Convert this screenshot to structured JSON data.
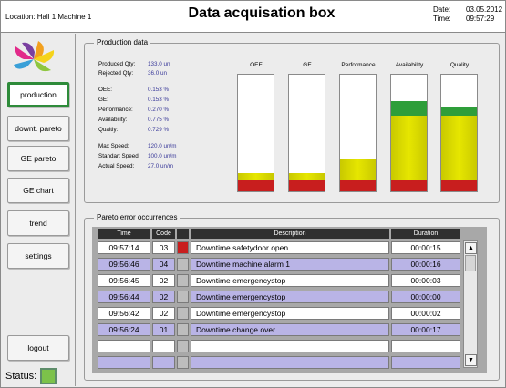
{
  "header": {
    "location": "Location: Hall 1 Machine 1",
    "title": "Data acquisation box",
    "date_label": "Date:",
    "date_value": "03.05.2012",
    "time_label": "Time:",
    "time_value": "09:57:29"
  },
  "sidebar": {
    "items": [
      {
        "label": "production",
        "active": true
      },
      {
        "label": "downt. pareto"
      },
      {
        "label": "GE pareto"
      },
      {
        "label": "GE chart"
      },
      {
        "label": "trend"
      },
      {
        "label": "settings"
      }
    ],
    "logout": "logout",
    "status_label": "Status:",
    "status_color": "#7cc24a"
  },
  "production": {
    "title": "Production data",
    "stats": [
      {
        "label": "Produced Qty:",
        "value": "133.0 un"
      },
      {
        "label": "Rejected Qty:",
        "value": "36.0 un"
      },
      {
        "label": "OEE:",
        "value": "0.153 %"
      },
      {
        "label": "GE:",
        "value": "0.153 %"
      },
      {
        "label": "Performance:",
        "value": "0.270  %"
      },
      {
        "label": "Availability:",
        "value": "0.775 %"
      },
      {
        "label": "Qualtiy:",
        "value": "0.729 %"
      },
      {
        "label": "Max Speed:",
        "value": "120.0 un/m"
      },
      {
        "label": "Standart Speed:",
        "value": "100.0 un/m"
      },
      {
        "label": "Actual Speed:",
        "value": "27.0 un/m"
      }
    ],
    "gauges": [
      {
        "label": "OEE",
        "fraction": 0.153
      },
      {
        "label": "GE",
        "fraction": 0.153
      },
      {
        "label": "Performance",
        "fraction": 0.27
      },
      {
        "label": "Availability",
        "fraction": 0.775
      },
      {
        "label": "Quality",
        "fraction": 0.729
      }
    ],
    "colors": {
      "red": "#c81e1e",
      "yellow": "#e6e600",
      "green": "#2e9e3a"
    }
  },
  "pareto": {
    "title": "Pareto error occurrences",
    "columns": [
      "Time",
      "Code",
      "",
      "Description",
      "Duration"
    ],
    "rows": [
      {
        "time": "09:57:14",
        "code": "03",
        "marker": "red",
        "description": "Downtime safetydoor open",
        "duration": "00:00:15"
      },
      {
        "time": "09:56:46",
        "code": "04",
        "marker": "",
        "description": "Downtime machine alarm 1",
        "duration": "00:00:16"
      },
      {
        "time": "09:56:45",
        "code": "02",
        "marker": "",
        "description": "Downtime emergencystop",
        "duration": "00:00:03"
      },
      {
        "time": "09:56:44",
        "code": "02",
        "marker": "",
        "description": "Downtime emergencystop",
        "duration": "00:00:00"
      },
      {
        "time": "09:56:42",
        "code": "02",
        "marker": "",
        "description": "Downtime emergencystop",
        "duration": "00:00:02"
      },
      {
        "time": "09:56:24",
        "code": "01",
        "marker": "",
        "description": "Downtime change over",
        "duration": "00:00:17"
      },
      {
        "time": "",
        "code": "",
        "marker": "",
        "description": "",
        "duration": ""
      },
      {
        "time": "",
        "code": "",
        "marker": "",
        "description": "",
        "duration": ""
      }
    ],
    "row_colors": {
      "odd": "#ffffff",
      "even": "#b9b4e6"
    }
  }
}
